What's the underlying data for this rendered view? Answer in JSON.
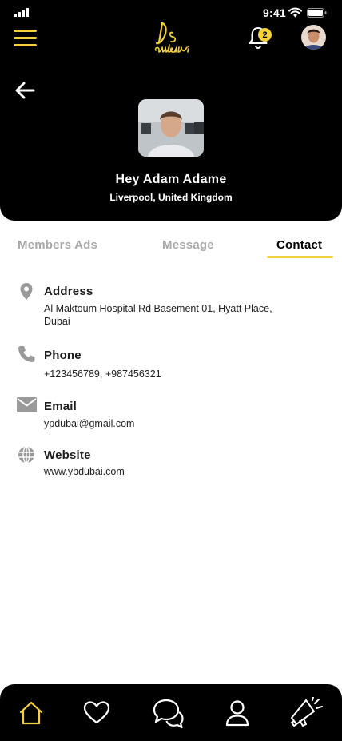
{
  "status_bar": {
    "time": "9:41",
    "icons": [
      "signal-icon",
      "wifi-icon",
      "battery-icon"
    ]
  },
  "header": {
    "notification_count": "2",
    "icons": [
      "menu-icon",
      "logo",
      "bell-icon",
      "user-avatar",
      "back-arrow-icon"
    ]
  },
  "profile": {
    "name": "Hey Adam Adame",
    "location": "Liverpool, United Kingdom"
  },
  "tabs": [
    {
      "label": "Members Ads",
      "active": false
    },
    {
      "label": "Message",
      "active": false
    },
    {
      "label": "Contact",
      "active": true
    }
  ],
  "contact": {
    "address": {
      "title": "Address",
      "value": "Al Maktoum Hospital Rd Basement 01, Hyatt Place, Dubai",
      "icon": "location-pin-icon"
    },
    "phone": {
      "title": "Phone",
      "value": "+123456789, +987456321",
      "icon": "phone-icon"
    },
    "email": {
      "title": "Email",
      "value": "ypdubai@gmail.com",
      "icon": "mail-icon"
    },
    "website": {
      "title": "Website",
      "value": "www.ybdubai.com",
      "icon": "globe-icon"
    }
  },
  "bottom_nav": {
    "items": [
      "home-icon",
      "heart-icon",
      "chat-icon",
      "profile-icon",
      "megaphone-icon"
    ],
    "active": "home-icon"
  },
  "colors": {
    "accent": "#f4d13a",
    "header_bg": "#000000",
    "inactive_tab": "#a9a9a9",
    "icon_gray": "#9a9a9a"
  }
}
